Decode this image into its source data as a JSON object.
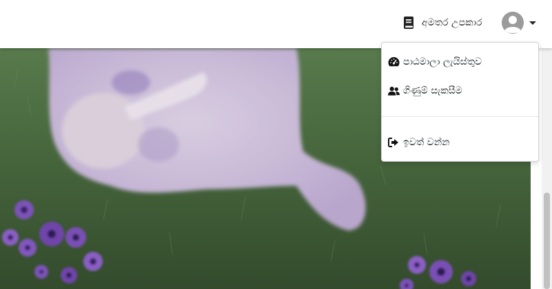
{
  "navbar": {
    "resources_label": "අමතර උපකාර",
    "resources_icon": "book-icon",
    "avatar_icon": "user-avatar-icon"
  },
  "dropdown": {
    "items": [
      {
        "label": "පාඨමාලා ලැයිස්තුව",
        "icon": "tachometer-icon"
      },
      {
        "label": "ගිණුම් සැකසීම",
        "icon": "users-icon"
      },
      {
        "label": "ඉවත් වන්න",
        "icon": "sign-out-icon"
      }
    ]
  },
  "colors": {
    "navbar_bg": "#ffffff",
    "text": "#212529",
    "avatar_bg": "#9b9b9b",
    "grass": "#3d5a35",
    "flower": "#7a4fb5"
  }
}
